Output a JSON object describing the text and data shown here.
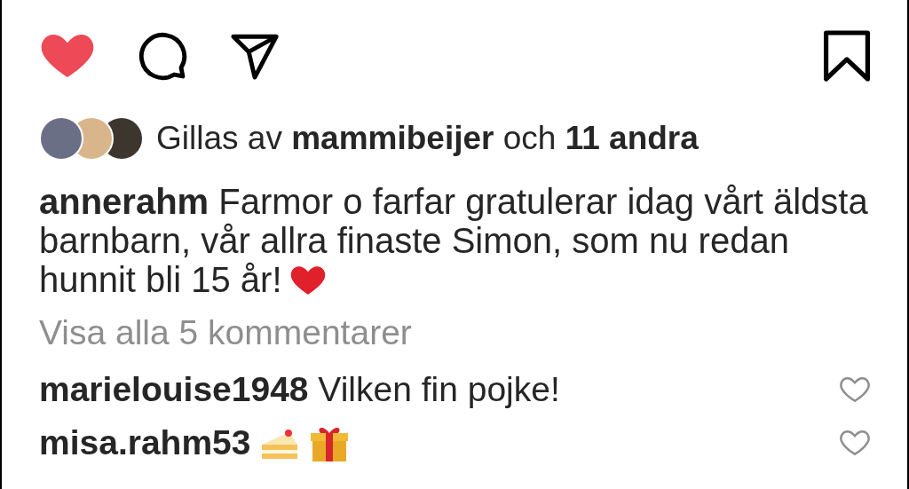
{
  "actions": {
    "liked": true,
    "saved": false
  },
  "likes": {
    "text": "Gillas av **mammibeijer** och **11 andra**"
  },
  "caption": {
    "username": "annerahm",
    "text": "Farmor o farfar gratulerar idag vårt äldsta barnbarn, vår allra finaste Simon, som nu redan hunnit bli 15 år!"
  },
  "view_comments": "Visa alla 5 kommentarer",
  "comments": [
    {
      "username": "marielouise1948",
      "text": "Vilken fin pojke!",
      "kind": "text",
      "liked": false
    },
    {
      "username": "misa.rahm53",
      "kind": "emoji",
      "liked": false
    }
  ]
}
